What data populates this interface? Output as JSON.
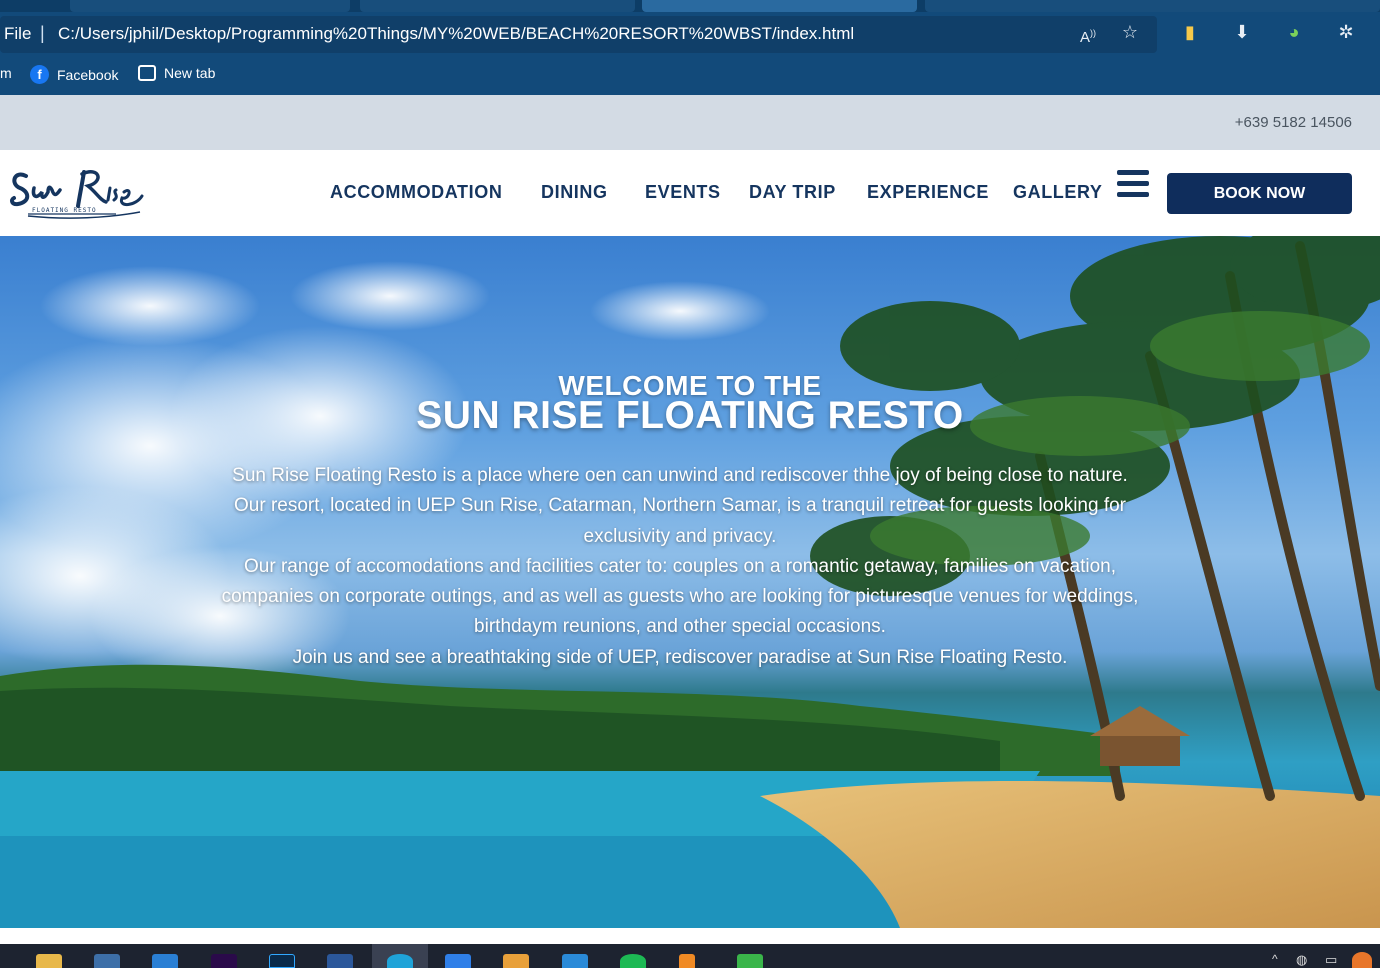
{
  "browser": {
    "file_label": "File",
    "url": "C:/Users/jphil/Desktop/Programming%20Things/MY%20WEB/BEACH%20RESORT%20WBST/index.html",
    "bookmarks": [
      {
        "label": "Facebook",
        "icon": "facebook-icon"
      },
      {
        "label": "New tab",
        "icon": "new-tab-icon"
      }
    ]
  },
  "topbar": {
    "phone": "+639 5182 14506"
  },
  "nav": {
    "items": [
      "ACCOMMODATION",
      "DINING",
      "EVENTS",
      "DAY TRIP",
      "EXPERIENCE",
      "GALLERY"
    ],
    "book_label": "BOOK NOW"
  },
  "hero": {
    "welcome": "WELCOME TO THE",
    "title": "SUN RISE FLOATING RESTO",
    "paragraph1": "Sun Rise Floating Resto is a place where oen can unwind and rediscover thhe joy of being close to nature. Our resort, located in UEP Sun Rise, Catarman, Northern Samar, is a tranquil retreat for guests looking for exclusivity and privacy.",
    "paragraph2": "Our range of accomodations and facilities cater to: couples on a romantic getaway, families on vacation, companies on corporate outings, and as well as guests who are looking for picturesque venues for weddings, birthdaym reunions, and other special occasions.",
    "paragraph3": "Join us and see a breathtaking side of UEP, rediscover paradise at Sun Rise Floating Resto."
  },
  "colors": {
    "nav_text": "#15355f",
    "book_button": "#0f2d5c",
    "browser_chrome": "#124a7a",
    "topbar": "#d3dbe4"
  }
}
